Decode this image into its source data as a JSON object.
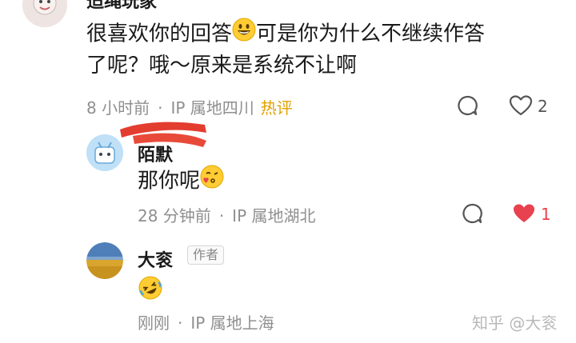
{
  "comments": [
    {
      "author": "迢绳玩家",
      "text_line1": "很喜欢你的回答",
      "text_line1_tail": "可是你为什么不继续作答",
      "text_line2": "了呢？哦～原来是系统不让啊",
      "time": "8 小时前",
      "location": "IP 属地四川",
      "tag": "热评",
      "like_count": "2",
      "emoji": "grinning-face"
    },
    {
      "author": "陌默",
      "text": "那你呢",
      "emoji": "kissing-face-with-heart",
      "time": "28 分钟前",
      "location": "IP 属地湖北",
      "like_count": "1",
      "liked": true
    },
    {
      "author": "大衮",
      "author_badge": "作者",
      "emoji": "rolling-on-floor-laughing",
      "time": "刚刚",
      "location": "IP 属地上海"
    }
  ],
  "watermark": "知乎 @大衮",
  "colors": {
    "hot_tag": "#e0a100",
    "like_active": "#e8414f",
    "meta_gray": "#8f8f8f"
  }
}
